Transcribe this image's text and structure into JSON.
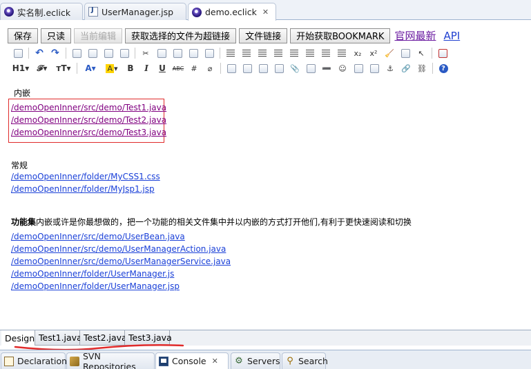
{
  "editor_tabs": [
    {
      "label": "实名制.eclick",
      "icon": "eclick-icon",
      "active": false
    },
    {
      "label": "UserManager.jsp",
      "icon": "jsp-file-icon",
      "active": false
    },
    {
      "label": "demo.eclick",
      "icon": "eclick-icon",
      "active": true,
      "close": "✕"
    }
  ],
  "toolbar": {
    "save": "保存",
    "readonly": "只读",
    "edit_current": "当前编辑",
    "get_links": "获取选择的文件为超链接",
    "file_link": "文件链接",
    "get_bookmark": "开始获取BOOKMARK",
    "official_site": "官网最新",
    "api": "API"
  },
  "format_bar": {
    "heading": "H1▾",
    "font": "𝓕▾",
    "size": "тT▾",
    "color": "A▾",
    "highlight": "A",
    "bold": "B",
    "italic": "I",
    "underline": "U",
    "strike": "ABC"
  },
  "content": {
    "embedded_label": "内嵌",
    "embedded_links": [
      "/demoOpenInner/src/demo/Test1.java",
      "/demoOpenInner/src/demo/Test2.java",
      "/demoOpenInner/src/demo/Test3.java"
    ],
    "normal_label": "常规",
    "normal_links": [
      "/demoOpenInner/folder/MyCSS1.css",
      "/demoOpenInner/folder/MyJsp1.jsp"
    ],
    "feature_bold": "功能集",
    "feature_text": "内嵌或许是你最想做的，把一个功能的相关文件集中并以内嵌的方式打开他们,有利于更快速阅读和切换",
    "feature_links": [
      "/demoOpenInner/src/demo/UserBean.java",
      "/demoOpenInner/src/demo/UserManagerAction.java",
      "/demoOpenInner/src/demo/UserManagerService.java",
      "/demoOpenInner/folder/UserManager.js",
      "/demoOpenInner/folder/UserManager.jsp"
    ]
  },
  "page_tabs": [
    "Design",
    "Test1.java",
    "Test2.java",
    "Test3.java"
  ],
  "view_tabs": [
    {
      "label": "Declaration",
      "icon": "declaration-icon"
    },
    {
      "label": "SVN Repositories",
      "icon": "svn-icon"
    },
    {
      "label": "Console",
      "icon": "console-icon",
      "active": true,
      "close": "✕"
    },
    {
      "label": "Servers",
      "icon": "servers-icon"
    },
    {
      "label": "Search",
      "icon": "search-icon"
    }
  ],
  "colors": {
    "annotation_red": "#e02b2b",
    "link_visited": "#800080",
    "link_blue": "#1a40d8"
  }
}
